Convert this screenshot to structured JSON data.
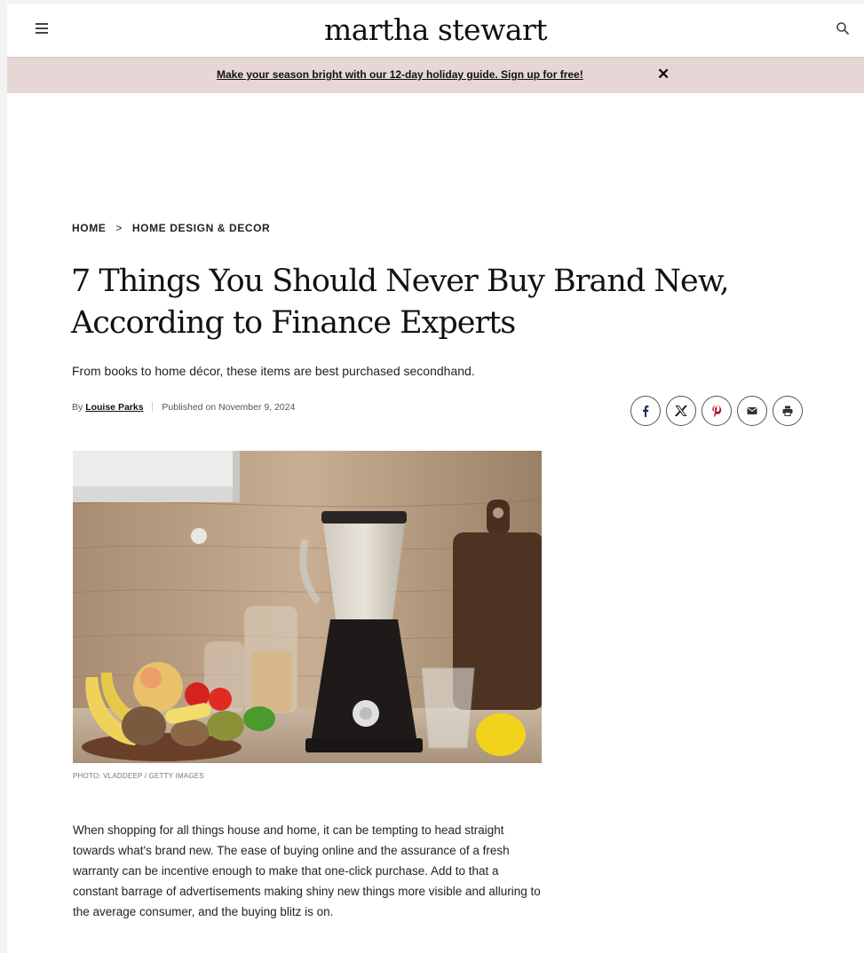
{
  "header": {
    "logo": "martha stewart",
    "menu_icon": "hamburger-menu-icon",
    "search_icon": "search-icon"
  },
  "banner": {
    "text": "Make your season bright with our 12-day holiday guide. Sign up for free!",
    "close": "✕",
    "background": "#e6d6d6"
  },
  "breadcrumb": {
    "items": [
      "HOME",
      "HOME DESIGN & DECOR"
    ],
    "separator": ">"
  },
  "article": {
    "title": "7 Things You Should Never Buy Brand New, According to Finance Experts",
    "subtitle": "From books to home décor, these items are best purchased secondhand.",
    "byline_prefix": "By",
    "author": "Louise Parks",
    "published": "Published on November 9, 2024",
    "photo_credit": "PHOTO: VLADDEEP / GETTY IMAGES",
    "body": "When shopping for all things house and home, it can be tempting to head straight towards what's brand new. The ease of buying online and the assurance of a fresh warranty can be incentive enough to make that one-click purchase. Add to that a constant barrage of advertisements making shiny new things more visible and alluring to the average consumer, and the buying blitz is on."
  },
  "share": {
    "icons": [
      "facebook-icon",
      "x-icon",
      "pinterest-icon",
      "email-icon",
      "print-icon"
    ]
  }
}
